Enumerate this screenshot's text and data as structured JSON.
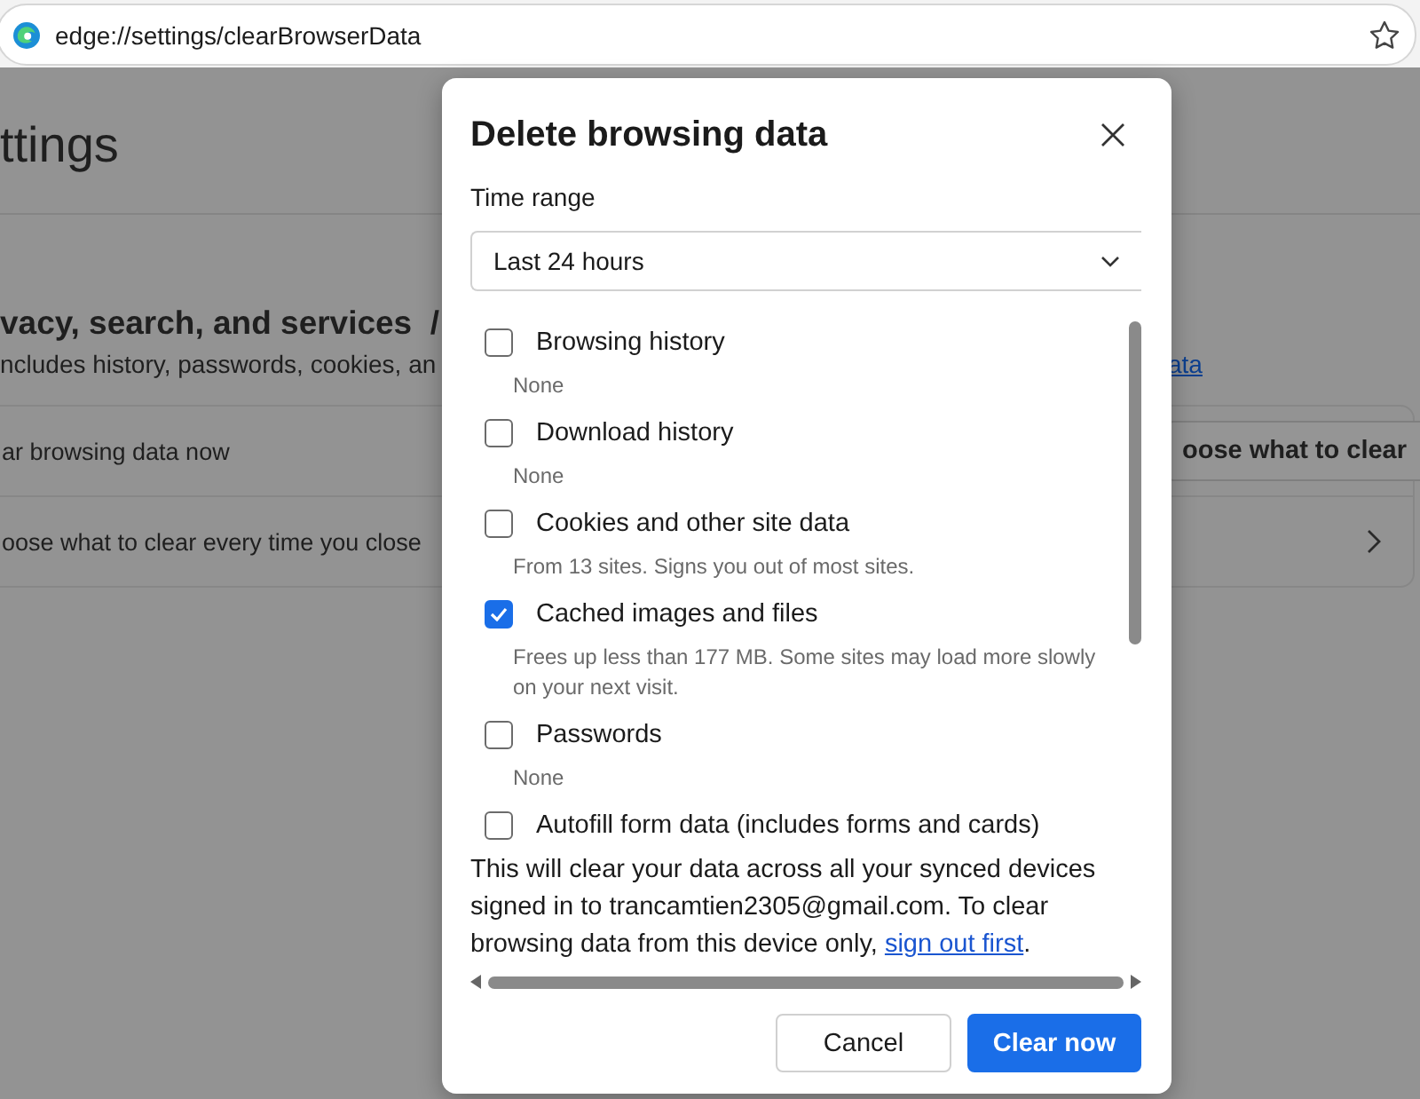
{
  "address_bar": {
    "url": "edge://settings/clearBrowserData"
  },
  "background_page": {
    "heading": "ttings",
    "section_title": "vacy, search, and services  /",
    "section_description": "ncludes history, passwords, cookies, an",
    "section_link": "ata",
    "rows": [
      {
        "label": "ar browsing data now",
        "button": "oose what to clear",
        "kind": "button"
      },
      {
        "label": "oose what to clear every time you close",
        "kind": "chevron"
      }
    ]
  },
  "dialog": {
    "title": "Delete browsing data",
    "time_range": {
      "label": "Time range",
      "value": "Last 24 hours"
    },
    "items": [
      {
        "label": "Browsing history",
        "detail": "None",
        "checked": false
      },
      {
        "label": "Download history",
        "detail": "None",
        "checked": false
      },
      {
        "label": "Cookies and other site data",
        "detail": "From 13 sites. Signs you out of most sites.",
        "checked": false
      },
      {
        "label": "Cached images and files",
        "detail": "Frees up less than 177 MB. Some sites may load more slowly on your next visit.",
        "checked": true
      },
      {
        "label": "Passwords",
        "detail": "None",
        "checked": false
      },
      {
        "label": "Autofill form data (includes forms and cards)",
        "checked": false
      }
    ],
    "notice": {
      "text": "This will clear your data across all your synced devices signed in to trancamtien2305@gmail.com. To clear browsing data from this device only, ",
      "link": "sign out first",
      "end": "."
    },
    "buttons": [
      {
        "label": "Cancel",
        "kind": "secondary"
      },
      {
        "label": "Clear now",
        "kind": "primary"
      }
    ]
  }
}
